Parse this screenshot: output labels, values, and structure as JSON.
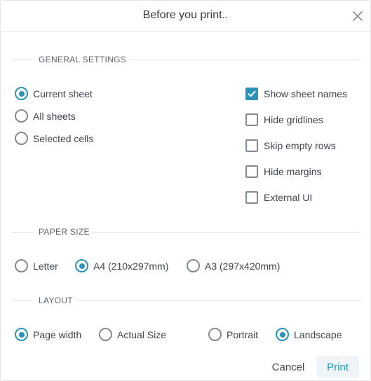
{
  "dialog": {
    "title": "Before you print..",
    "close_icon": "close-icon"
  },
  "general": {
    "label": "GENERAL SETTINGS",
    "scope_options": [
      {
        "label": "Current sheet",
        "selected": true
      },
      {
        "label": "All sheets",
        "selected": false
      },
      {
        "label": "Selected cells",
        "selected": false
      }
    ],
    "checkboxes": [
      {
        "label": "Show sheet names",
        "checked": true
      },
      {
        "label": "Hide gridlines",
        "checked": false
      },
      {
        "label": "Skip empty rows",
        "checked": false
      },
      {
        "label": "Hide margins",
        "checked": false
      },
      {
        "label": "External UI",
        "checked": false
      }
    ]
  },
  "paper": {
    "label": "PAPER SIZE",
    "options": [
      {
        "label": "Letter",
        "selected": false
      },
      {
        "label": "A4 (210x297mm)",
        "selected": true
      },
      {
        "label": "A3 (297x420mm)",
        "selected": false
      }
    ]
  },
  "layout": {
    "label": "LAYOUT",
    "fit_options": [
      {
        "label": "Page width",
        "selected": true
      },
      {
        "label": "Actual Size",
        "selected": false
      }
    ],
    "orientation_options": [
      {
        "label": "Portrait",
        "selected": false
      },
      {
        "label": "Landscape",
        "selected": true
      }
    ]
  },
  "actions": {
    "cancel_label": "Cancel",
    "print_label": "Print"
  },
  "colors": {
    "accent": "#2c93b8",
    "border": "#828a93",
    "text": "#3b4652"
  }
}
